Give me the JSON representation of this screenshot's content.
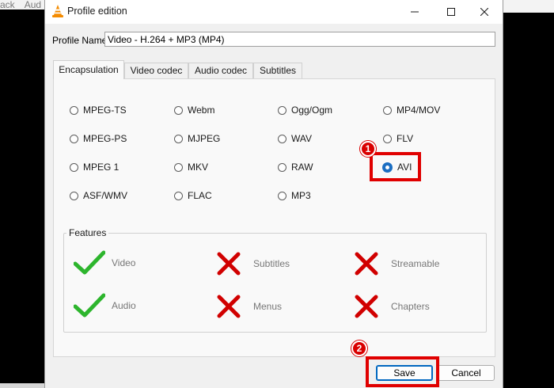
{
  "background": {
    "left_tabs": [
      "ack",
      "Aud"
    ]
  },
  "window": {
    "title": "Profile edition",
    "app_icon": "vlc-cone-icon",
    "controls": {
      "minimize_icon": "minimize-icon",
      "maximize_icon": "maximize-icon",
      "close_icon": "close-icon"
    }
  },
  "profile": {
    "label": "Profile Name",
    "value": "Video - H.264 + MP3 (MP4)"
  },
  "tabs": [
    {
      "label": "Encapsulation",
      "active": true
    },
    {
      "label": "Video codec",
      "active": false
    },
    {
      "label": "Audio codec",
      "active": false
    },
    {
      "label": "Subtitles",
      "active": false
    }
  ],
  "encapsulation": {
    "options": [
      {
        "label": "MPEG-TS",
        "checked": false
      },
      {
        "label": "MPEG-PS",
        "checked": false
      },
      {
        "label": "MPEG 1",
        "checked": false
      },
      {
        "label": "ASF/WMV",
        "checked": false
      },
      {
        "label": "Webm",
        "checked": false
      },
      {
        "label": "MJPEG",
        "checked": false
      },
      {
        "label": "MKV",
        "checked": false
      },
      {
        "label": "FLAC",
        "checked": false
      },
      {
        "label": "Ogg/Ogm",
        "checked": false
      },
      {
        "label": "WAV",
        "checked": false
      },
      {
        "label": "RAW",
        "checked": false
      },
      {
        "label": "MP3",
        "checked": false
      },
      {
        "label": "MP4/MOV",
        "checked": false
      },
      {
        "label": "FLV",
        "checked": false
      },
      {
        "label": "AVI",
        "checked": true
      }
    ]
  },
  "features": {
    "title": "Features",
    "items": [
      {
        "label": "Video",
        "supported": true,
        "icon": "check-icon"
      },
      {
        "label": "Audio",
        "supported": true,
        "icon": "check-icon"
      },
      {
        "label": "Subtitles",
        "supported": false,
        "icon": "cross-icon"
      },
      {
        "label": "Menus",
        "supported": false,
        "icon": "cross-icon"
      },
      {
        "label": "Streamable",
        "supported": false,
        "icon": "cross-icon"
      },
      {
        "label": "Chapters",
        "supported": false,
        "icon": "cross-icon"
      }
    ],
    "colors": {
      "check": "#2db52d",
      "cross": "#d10000"
    }
  },
  "buttons": {
    "save": "Save",
    "cancel": "Cancel"
  },
  "annotations": [
    {
      "number": "1",
      "target": "AVI"
    },
    {
      "number": "2",
      "target": "Save"
    }
  ],
  "colors": {
    "annotation_red": "#e00000",
    "radio_checked": "#1b6ec2"
  }
}
